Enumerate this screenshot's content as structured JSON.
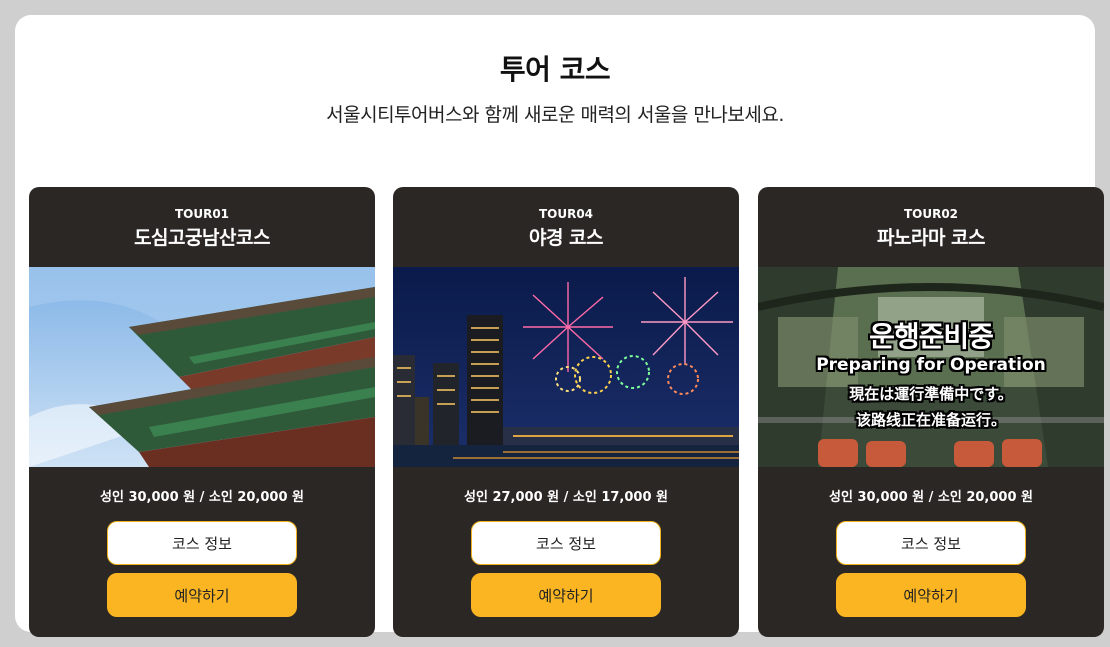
{
  "section": {
    "title": "투어 코스",
    "subtitle": "서울시티투어버스와 함께 새로운 매력의 서울을 만나보세요."
  },
  "cards": [
    {
      "code": "TOUR01",
      "name": "도심고궁남산코스",
      "image_icon": "palace-roof-image",
      "price": "성인 30,000 원 / 소인 20,000 원",
      "info_label": "코스 정보",
      "reserve_label": "예약하기"
    },
    {
      "code": "TOUR04",
      "name": "야경 코스",
      "image_icon": "fireworks-night-image",
      "price": "성인 27,000 원 / 소인 17,000 원",
      "info_label": "코스 정보",
      "reserve_label": "예약하기"
    },
    {
      "code": "TOUR02",
      "name": "파노라마 코스",
      "image_icon": "bus-interior-image",
      "overlay": {
        "line1": "운행준비중",
        "line2": "Preparing for Operation",
        "line3": "現在は運行準備中です。",
        "line4": "该路线正在准备运行。"
      },
      "price": "성인 30,000 원 / 소인 20,000 원",
      "info_label": "코스 정보",
      "reserve_label": "예약하기"
    }
  ],
  "colors": {
    "page_bg": "#cfcfcf",
    "card_bg": "#2b2725",
    "accent": "#fbb522"
  }
}
